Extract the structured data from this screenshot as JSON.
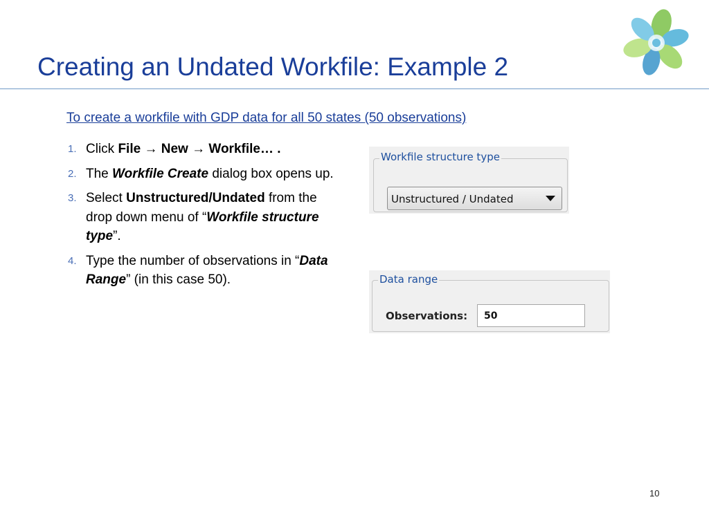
{
  "slide": {
    "title": "Creating an Undated Workfile: Example 2",
    "subtitle": "To create a workfile with GDP data for all 50 states (50 observations)",
    "page_number": "10"
  },
  "steps": [
    {
      "number": "1.",
      "parts": {
        "a": "Click ",
        "b": "File → New → Workfile… ."
      }
    },
    {
      "number": "2.",
      "parts": {
        "a": "The ",
        "b": "Workfile Create",
        "c": " dialog box opens up."
      }
    },
    {
      "number": "3.",
      "parts": {
        "a": "Select ",
        "b": "Unstructured",
        "c": "/",
        "d": "Undated",
        "e": " from the drop down menu of “",
        "f": "Workfile structure type",
        "g": "”."
      }
    },
    {
      "number": "4.",
      "parts": {
        "a": "Type the number of observations in “",
        "b": "Data Range",
        "c": "” (in this case 50)."
      }
    }
  ],
  "workfile_structure": {
    "legend": "Workfile structure type",
    "selected": "Unstructured / Undated"
  },
  "data_range": {
    "legend": "Data range",
    "observations_label": "Observations:",
    "observations_value": "50"
  },
  "colors": {
    "title": "#1a3e99",
    "rule": "#6f9ac7",
    "legend": "#1d4f9e",
    "panel_bg": "#f0f0f0"
  },
  "icons": {
    "logo": "swirl-logo",
    "dropdown": "chevron-down-icon"
  }
}
